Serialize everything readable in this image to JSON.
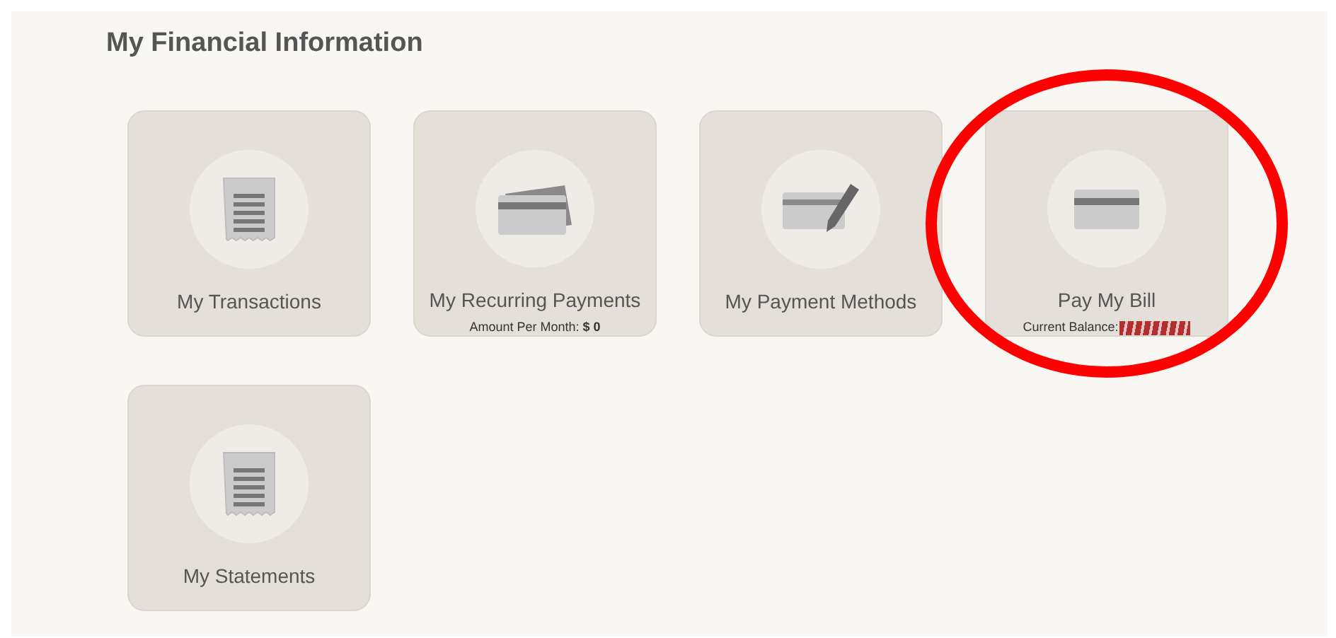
{
  "title": "My Financial Information",
  "tiles": [
    {
      "label": "My Transactions",
      "kind": "receipt",
      "highlighted": false
    },
    {
      "label": "My Recurring Payments",
      "kind": "cards",
      "highlighted": false,
      "note": "Amount Per Month: **$ 0**"
    },
    {
      "label": "My Payment Methods",
      "kind": "card-pen",
      "highlighted": false
    },
    {
      "label": "Pay My Bill",
      "kind": "card",
      "highlighted": true,
      "note": "Current Balance:",
      "redacted": true
    },
    {
      "label": "My Statements",
      "kind": "receipt",
      "highlighted": false
    }
  ]
}
